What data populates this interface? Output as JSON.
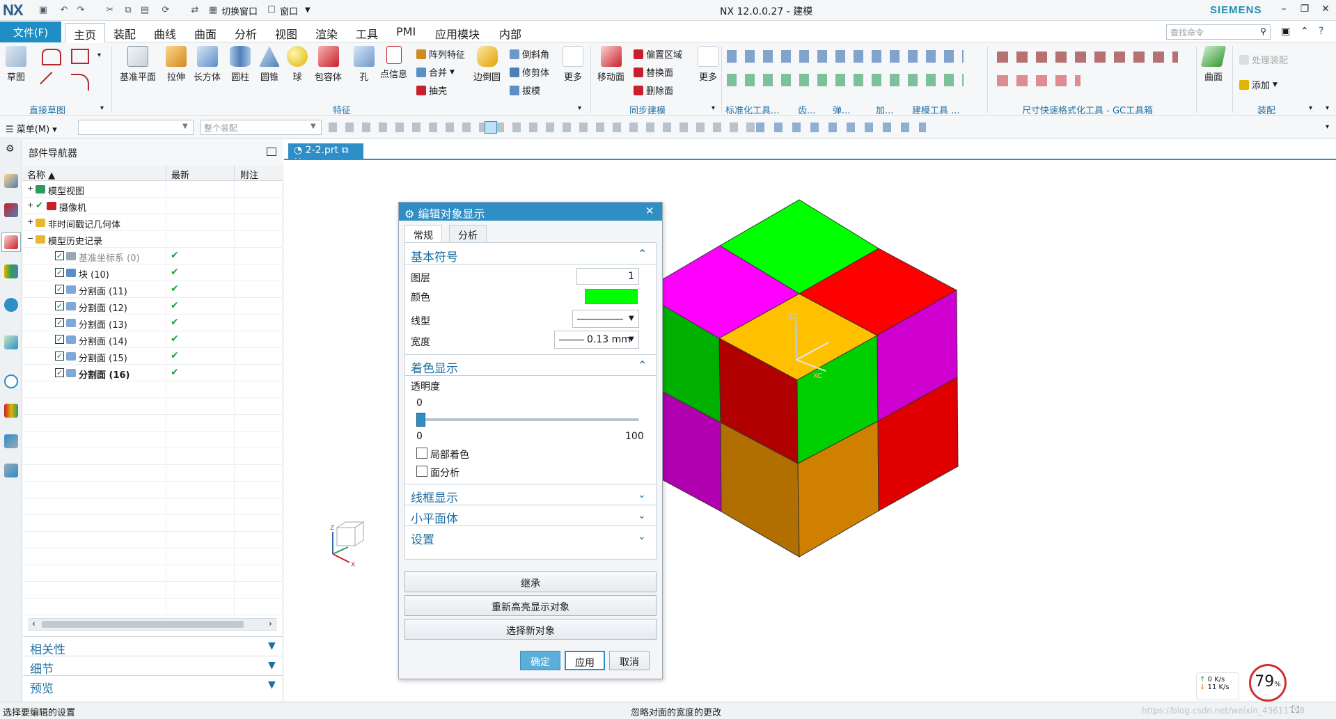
{
  "titlebar": {
    "logo": "NX",
    "switch_window": "切换窗口",
    "window_menu": "窗口",
    "title": "NX 12.0.0.27 - 建模",
    "brand": "SIEMENS"
  },
  "menubar": {
    "file": "文件(F)",
    "tabs": [
      "主页",
      "装配",
      "曲线",
      "曲面",
      "分析",
      "视图",
      "渲染",
      "工具",
      "PMI",
      "应用模块",
      "内部"
    ],
    "search_placeholder": "查找命令"
  },
  "ribbon": {
    "sketch": "草图",
    "direct_sketch_group": "直接草图",
    "datum_plane": "基准平面",
    "extrude": "拉伸",
    "block": "长方体",
    "cylinder": "圆柱",
    "cone": "圆锥",
    "sphere": "球",
    "bounding_body": "包容体",
    "hole": "孔",
    "info_point": "点信息",
    "pattern_feature": "阵列特征",
    "unite": "合并",
    "shell": "抽壳",
    "edge_blend": "边倒圆",
    "chamfer": "倒斜角",
    "trim_body": "修剪体",
    "draft": "拔模",
    "more": "更多",
    "feature_group": "特征",
    "move_face": "移动面",
    "offset_region": "偏置区域",
    "replace_face": "替换面",
    "delete_face": "删除面",
    "more2": "更多",
    "sync_group": "同步建模",
    "std_tools": "标准化工具...",
    "gear": "齿...",
    "spring": "弹...",
    "add": "加...",
    "model_tools": "建模工具 ...",
    "dim_tools": "尺寸快速格式化工具 - GC工具箱",
    "surface": "曲面",
    "process_assembly": "处理装配",
    "add_btn": "添加",
    "assembly_group": "装配"
  },
  "cmdbar": {
    "menu": "菜单(M)",
    "filter_value": "",
    "scope_placeholder": "整个装配"
  },
  "navigator": {
    "title": "部件导航器",
    "col_name": "名称",
    "col_latest": "最新",
    "col_note": "附注",
    "rows": [
      {
        "label": "模型视图"
      },
      {
        "label": "摄像机"
      },
      {
        "label": "非时间戳记几何体"
      },
      {
        "label": "模型历史记录"
      },
      {
        "label": "基准坐标系 (0)"
      },
      {
        "label": "块 (10)"
      },
      {
        "label": "分割面 (11)"
      },
      {
        "label": "分割面 (12)"
      },
      {
        "label": "分割面 (13)"
      },
      {
        "label": "分割面 (14)"
      },
      {
        "label": "分割面 (15)"
      },
      {
        "label": "分割面 (16)"
      }
    ],
    "sections": [
      "相关性",
      "细节",
      "预览"
    ]
  },
  "viewport": {
    "tab": "2-2.prt",
    "axis_z": "ZC",
    "axis_x": "XC",
    "triad_z": "Z",
    "triad_x": "X"
  },
  "dialog": {
    "title": "编辑对象显示",
    "tabs": [
      "常规",
      "分析"
    ],
    "basic_symbol": "基本符号",
    "layer_label": "图层",
    "layer_value": "1",
    "color_label": "颜色",
    "color_value": "#00ff00",
    "linetype_label": "线型",
    "width_label": "宽度",
    "width_value": "0.13 mm",
    "shading": "着色显示",
    "transparency_label": "透明度",
    "transparency_value": "0",
    "slider_min": "0",
    "slider_max": "100",
    "local_shading": "局部着色",
    "face_analysis": "面分析",
    "wireframe": "线框显示",
    "facets": "小平面体",
    "settings": "设置",
    "inherit": "继承",
    "rehighlight": "重新高亮显示对象",
    "select_new": "选择新对象",
    "ok": "确定",
    "apply": "应用",
    "cancel": "取消"
  },
  "net_widget": {
    "up": "0  K/s",
    "down": "11  K/s",
    "percent": "79",
    "percent_unit": "%"
  },
  "statusbar": {
    "left": "选择要编辑的设置",
    "center": "忽略对面的宽度的更改",
    "watermark": "https://blog.csdn.net/weixin_43611798"
  },
  "colors": {
    "accent": "#1e8ec5",
    "cube_green": "#00ff00",
    "cube_red": "#ff0000",
    "cube_magenta": "#ff00ff",
    "cube_orange": "#ffc000"
  }
}
